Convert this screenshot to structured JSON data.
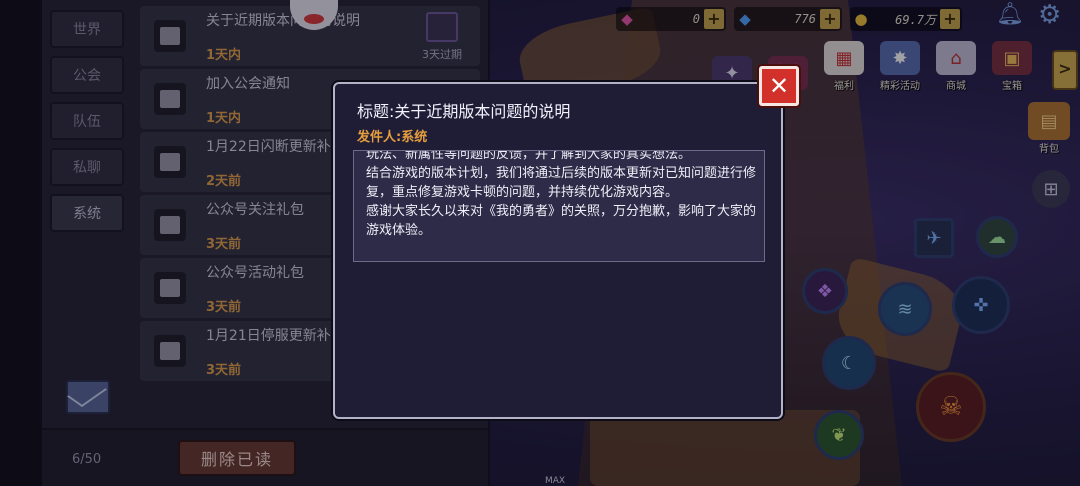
{
  "top": {
    "gems": "0",
    "crystals": "776",
    "coins": "69.7万"
  },
  "menu": {
    "items": [
      {
        "label": "",
        "icon": "event-icon"
      },
      {
        "label": "",
        "icon": "gift-icon"
      },
      {
        "label": "福利",
        "icon": "calendar-icon"
      },
      {
        "label": "精彩活动",
        "icon": "star-icon"
      },
      {
        "label": "商城",
        "icon": "shop-icon"
      },
      {
        "label": "宝箱",
        "icon": "chest-icon"
      }
    ],
    "bag_label": "背包",
    "expand_arrow": ">"
  },
  "mail": {
    "tabs": [
      "世界",
      "公会",
      "队伍",
      "私聊",
      "系统"
    ],
    "items": [
      {
        "subject": "关于近期版本问题的说明",
        "time": "1天内",
        "expire": "3天过期"
      },
      {
        "subject": "加入公会通知",
        "time": "1天内",
        "expire": ""
      },
      {
        "subject": "1月22日闪断更新补",
        "time": "2天前",
        "expire": ""
      },
      {
        "subject": "公众号关注礼包",
        "time": "3天前",
        "expire": ""
      },
      {
        "subject": "公众号活动礼包",
        "time": "3天前",
        "expire": ""
      },
      {
        "subject": "1月21日停服更新补",
        "time": "3天前",
        "expire": ""
      }
    ],
    "count": "6/50",
    "delete_read": "删除已读"
  },
  "dialog": {
    "title": "标题:关于近期版本问题的说明",
    "sender": "发件人:系统",
    "close": "✕",
    "paragraphs": [
      "玩法、新属性等问题的反馈，并了解到大家的真实想法。",
      "结合游戏的版本计划，我们将通过后续的版本更新对已知问题进行修复，重点修复游戏卡顿的问题，并持续优化游戏内容。",
      "感谢大家长久以来对《我的勇者》的关照，万分抱歉，影响了大家的游戏体验。"
    ]
  },
  "colors": {
    "accent_orange": "#e59d3e",
    "close_red": "#d2302b",
    "panel_bg": "#262533"
  },
  "misc": {
    "hp_label": "MAX"
  }
}
